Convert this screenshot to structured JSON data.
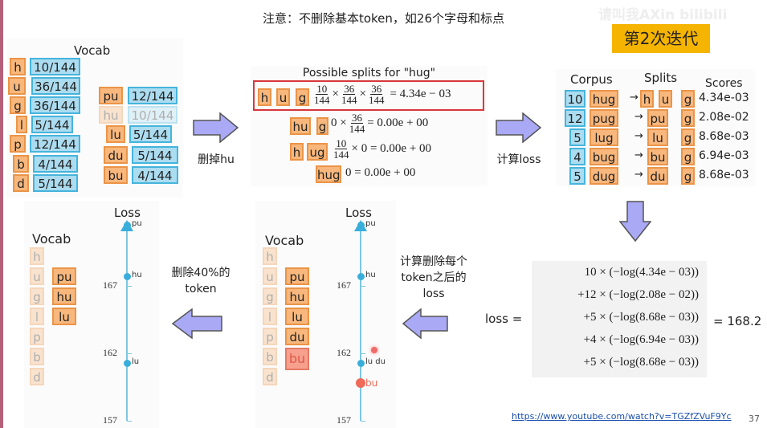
{
  "title": "注意：不删除基本token，如26个字母和标点",
  "watermark": "请叫我AXin bilibili",
  "iteration_badge": "第2次迭代",
  "vocab_panel": {
    "title": "Vocab",
    "chars": [
      {
        "t": "h",
        "f": "10/144"
      },
      {
        "t": "u",
        "f": "36/144"
      },
      {
        "t": "g",
        "f": "36/144"
      },
      {
        "t": "l",
        "f": "5/144"
      },
      {
        "t": "p",
        "f": "12/144"
      },
      {
        "t": "b",
        "f": "4/144"
      },
      {
        "t": "d",
        "f": "5/144"
      }
    ],
    "subwords": [
      {
        "t": "pu",
        "f": "12/144"
      },
      {
        "t": "hu",
        "f": "10/144"
      },
      {
        "t": "lu",
        "f": "5/144"
      },
      {
        "t": "du",
        "f": "5/144"
      },
      {
        "t": "bu",
        "f": "4/144"
      }
    ]
  },
  "arrow1_label": "删掉hu",
  "splits_panel": {
    "title": "Possible splits for \"hug\"",
    "row1": {
      "tokens": [
        "h",
        "u",
        "g"
      ],
      "n1": "10",
      "n2": "36",
      "n3": "36",
      "d": "144",
      "times": "×",
      "result": "= 4.34e − 03"
    },
    "row2": {
      "tokens": [
        "hu",
        "g"
      ],
      "pre": "0 ×",
      "n": "36",
      "d": "144",
      "result": "= 0.00e + 00"
    },
    "row3": {
      "tokens": [
        "h",
        "ug"
      ],
      "n": "10",
      "d": "144",
      "post": "× 0 = 0.00e + 00"
    },
    "row4": {
      "tokens": [
        "hug"
      ],
      "result": "0 = 0.00e + 00"
    }
  },
  "arrow2_label": "计算loss",
  "corpus_panel": {
    "headers": {
      "corpus": "Corpus",
      "splits": "Splits",
      "scores": "Scores"
    },
    "arrow": "→",
    "rows": [
      {
        "count": "10",
        "word": "hug",
        "splits": [
          "h",
          "u",
          "g"
        ],
        "score": "4.34e-03"
      },
      {
        "count": "12",
        "word": "pug",
        "splits": [
          "pu",
          "g"
        ],
        "score": "2.08e-02"
      },
      {
        "count": "5",
        "word": "lug",
        "splits": [
          "lu",
          "g"
        ],
        "score": "8.68e-03"
      },
      {
        "count": "4",
        "word": "bug",
        "splits": [
          "bu",
          "g"
        ],
        "score": "6.94e-03"
      },
      {
        "count": "5",
        "word": "dug",
        "splits": [
          "du",
          "g"
        ],
        "score": "8.68e-03"
      }
    ]
  },
  "loss_formula": {
    "label": "loss =",
    "terms": [
      "10 × (−log(4.34e − 03))",
      "+12 × (−log(2.08e − 02))",
      "+5 × (−log(8.68e − 03))",
      "+4 × (−log(6.94e − 03))",
      "+5 × (−log(8.68e − 03))"
    ],
    "result": "= 168.2"
  },
  "arrow3_label": "计算删除每个token之后的loss",
  "mid_panel": {
    "title": "Vocab",
    "chars": [
      "h",
      "u",
      "g",
      "l",
      "p",
      "b",
      "d"
    ],
    "subwords": [
      "pu",
      "hu",
      "lu",
      "du",
      "bu"
    ],
    "axis": {
      "title": "Loss",
      "ticks": [
        "167",
        "162",
        "157"
      ],
      "points": [
        {
          "label": "pu",
          "loss": 171.5
        },
        {
          "label": "hu",
          "loss": 167.7
        },
        {
          "label": "lu du",
          "loss": 161.3
        },
        {
          "label": "bu",
          "loss": 159.8
        }
      ]
    }
  },
  "arrow4_label": "删除40%的 token",
  "left_panel": {
    "title": "Vocab",
    "chars": [
      "h",
      "u",
      "g",
      "l",
      "p",
      "b",
      "d"
    ],
    "subwords": [
      "pu",
      "hu",
      "lu"
    ],
    "axis": {
      "title": "Loss",
      "ticks": [
        "167",
        "162",
        "157"
      ],
      "points": [
        {
          "label": "pu",
          "loss": 171.5
        },
        {
          "label": "hu",
          "loss": 167.7
        },
        {
          "label": "lu",
          "loss": 161.3
        }
      ]
    }
  },
  "footer": {
    "link": "https://www.youtube.com/watch?v=TGZfZVuF9Yc",
    "page": "37"
  },
  "colors": {
    "token_orange": "#f8b77c",
    "token_blue": "#acdcf0",
    "badge": "#f5b400",
    "highlight_red": "#d9373b",
    "arrow": "#a9a9f5"
  }
}
